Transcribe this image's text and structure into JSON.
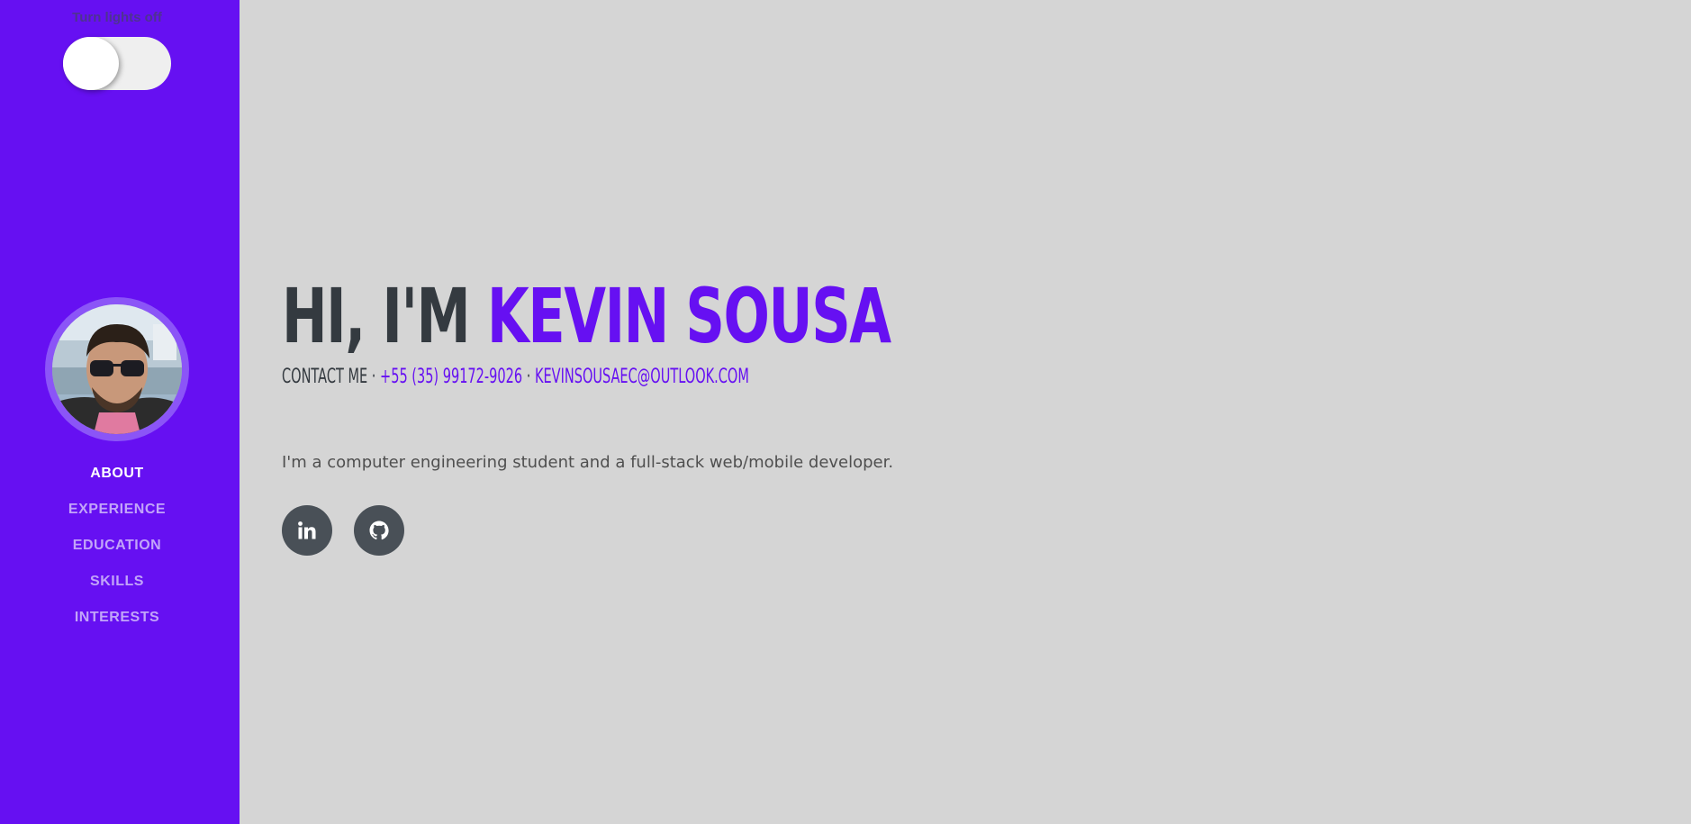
{
  "sidebar": {
    "toggle_label": "Turn lights off",
    "nav": [
      {
        "label": "ABOUT",
        "active": true
      },
      {
        "label": "EXPERIENCE",
        "active": false
      },
      {
        "label": "EDUCATION",
        "active": false
      },
      {
        "label": "SKILLS",
        "active": false
      },
      {
        "label": "INTERESTS",
        "active": false
      }
    ]
  },
  "hero": {
    "greeting": "HI, I'M",
    "name": "KEVIN SOUSA",
    "contact_prefix": "CONTACT ME",
    "separator": "·",
    "phone": "+55 (35) 99172-9026",
    "email": "KEVINSOUSAEC@OUTLOOK.COM",
    "lead": "I'm a computer engineering student and a full-stack web/mobile developer."
  },
  "socials": [
    {
      "icon": "linkedin-icon"
    },
    {
      "icon": "github-icon"
    }
  ],
  "colors": {
    "primary": "#6610f2",
    "background": "#d5d5d5",
    "heading": "#343a40",
    "social_button": "#495057"
  }
}
